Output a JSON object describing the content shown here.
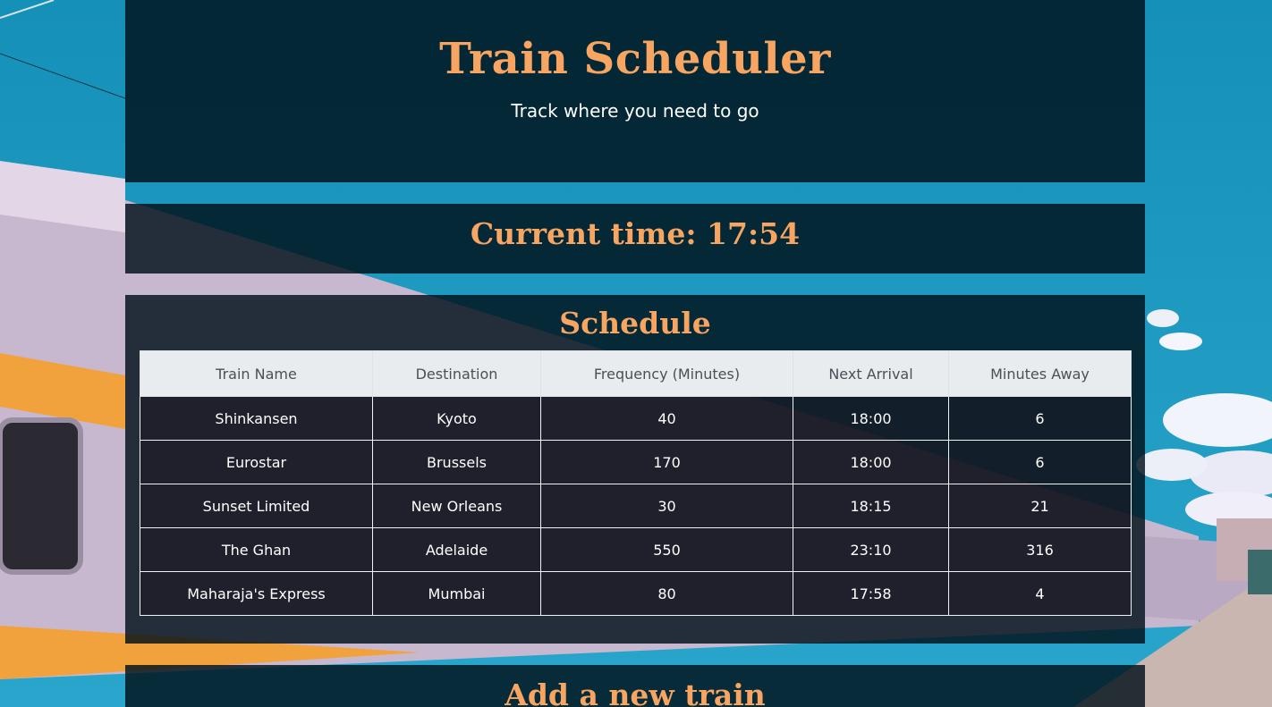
{
  "header": {
    "title": "Train Scheduler",
    "subtitle": "Track where you need to go"
  },
  "clock": {
    "label": "Current time:",
    "time": "17:54"
  },
  "schedule": {
    "heading": "Schedule",
    "columns": [
      "Train Name",
      "Destination",
      "Frequency (Minutes)",
      "Next Arrival",
      "Minutes Away"
    ],
    "rows": [
      [
        "Shinkansen",
        "Kyoto",
        "40",
        "18:00",
        "6"
      ],
      [
        "Eurostar",
        "Brussels",
        "170",
        "18:00",
        "6"
      ],
      [
        "Sunset Limited",
        "New Orleans",
        "30",
        "18:15",
        "21"
      ],
      [
        "The Ghan",
        "Adelaide",
        "550",
        "23:10",
        "316"
      ],
      [
        "Maharaja's Express",
        "Mumbai",
        "80",
        "17:58",
        "4"
      ]
    ]
  },
  "add_train": {
    "heading": "Add a new train"
  },
  "colors": {
    "accent": "#f7a560",
    "panel": "#001018",
    "table_header_bg": "#e9ecef"
  }
}
